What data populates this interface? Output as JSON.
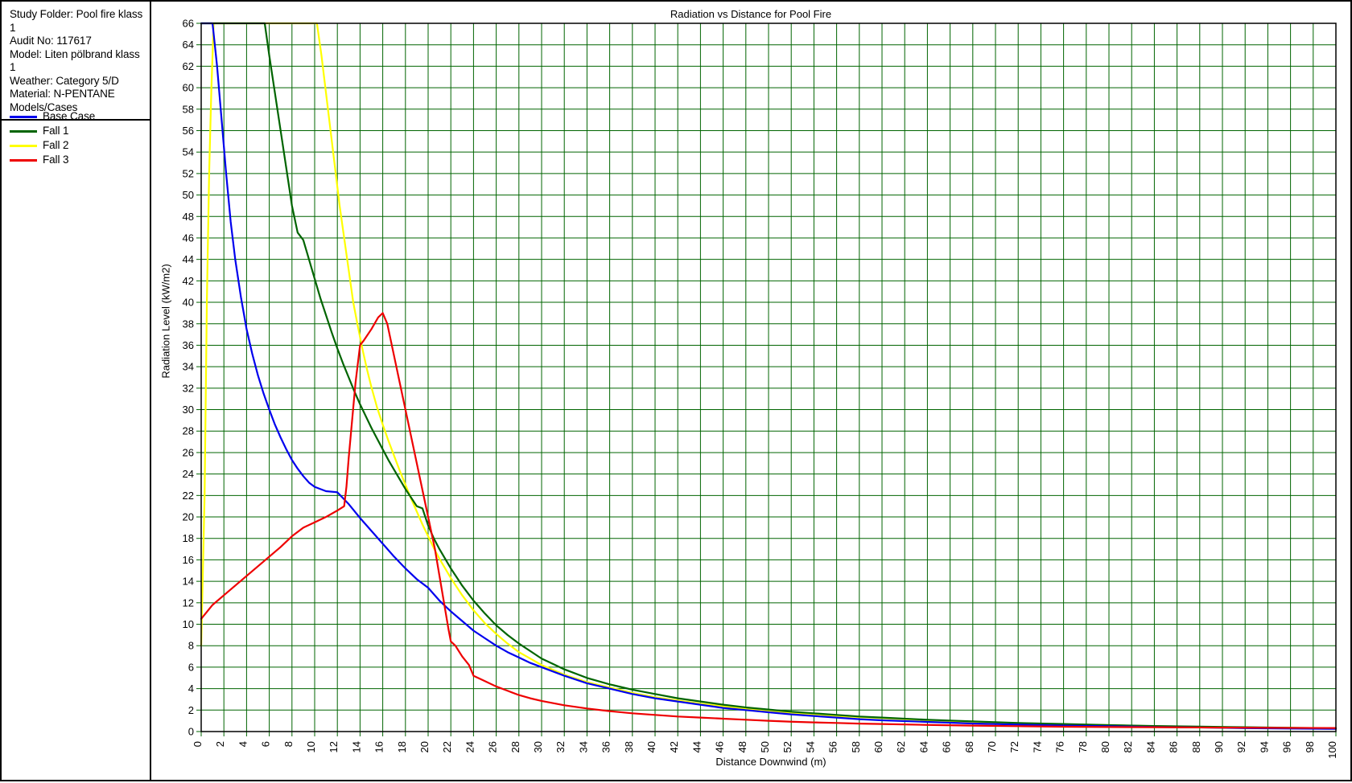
{
  "window": {
    "title": "Radiation vs Distance for Pool Fire"
  },
  "info_panel": {
    "lines": [
      "Study Folder: Pool fire klass 1",
      "Audit No: 117617",
      "Model: Liten pölbrand klass 1",
      "Weather: Category 5/D",
      "Material: N-PENTANE",
      "Models/Cases"
    ]
  },
  "legend": {
    "position": "left-panel",
    "items": [
      {
        "label": "Base Case",
        "color": "#0000ee"
      },
      {
        "label": "Fall 1",
        "color": "#006400"
      },
      {
        "label": "Fall 2",
        "color": "#ffff00"
      },
      {
        "label": "Fall 3",
        "color": "#ee0000"
      }
    ]
  },
  "chart_data": {
    "type": "line",
    "title": "Radiation vs Distance for Pool Fire",
    "xlabel": "Distance Downwind (m)",
    "ylabel": "Radiation Level (kW/m2)",
    "xlim": [
      0,
      100
    ],
    "ylim": [
      0,
      66
    ],
    "xticks": [
      0,
      2,
      4,
      6,
      8,
      10,
      12,
      14,
      16,
      18,
      20,
      22,
      24,
      26,
      28,
      30,
      32,
      34,
      36,
      38,
      40,
      42,
      44,
      46,
      48,
      50,
      52,
      54,
      56,
      58,
      60,
      62,
      64,
      66,
      68,
      70,
      72,
      74,
      76,
      78,
      80,
      82,
      84,
      86,
      88,
      90,
      92,
      94,
      96,
      98,
      100
    ],
    "yticks": [
      0,
      2,
      4,
      6,
      8,
      10,
      12,
      14,
      16,
      18,
      20,
      22,
      24,
      26,
      28,
      30,
      32,
      34,
      36,
      38,
      40,
      42,
      44,
      46,
      48,
      50,
      52,
      54,
      56,
      58,
      60,
      62,
      64,
      66
    ],
    "grid": true,
    "grid_color": "#006400",
    "axis_color": "#000000",
    "legend_position": "left-panel",
    "series": [
      {
        "name": "Base Case",
        "color": "#0000ee",
        "points": [
          [
            0.0,
            66.0
          ],
          [
            1.0,
            66.0
          ],
          [
            1.4,
            62.0
          ],
          [
            1.8,
            57.0
          ],
          [
            2.2,
            52.0
          ],
          [
            2.6,
            47.5
          ],
          [
            3.0,
            44.0
          ],
          [
            3.5,
            40.5
          ],
          [
            4.0,
            37.5
          ],
          [
            4.5,
            35.2
          ],
          [
            5.0,
            33.2
          ],
          [
            5.5,
            31.5
          ],
          [
            6.0,
            30.0
          ],
          [
            6.5,
            28.6
          ],
          [
            7.0,
            27.4
          ],
          [
            7.5,
            26.3
          ],
          [
            8.0,
            25.3
          ],
          [
            8.5,
            24.5
          ],
          [
            9.0,
            23.8
          ],
          [
            9.5,
            23.2
          ],
          [
            10.0,
            22.8
          ],
          [
            11.0,
            22.4
          ],
          [
            12.0,
            22.3
          ],
          [
            13.0,
            21.2
          ],
          [
            14.0,
            19.9
          ],
          [
            15.0,
            18.7
          ],
          [
            16.0,
            17.5
          ],
          [
            17.0,
            16.3
          ],
          [
            18.0,
            15.2
          ],
          [
            19.0,
            14.2
          ],
          [
            20.0,
            13.4
          ],
          [
            21.0,
            12.2
          ],
          [
            22.0,
            11.2
          ],
          [
            23.0,
            10.3
          ],
          [
            24.0,
            9.4
          ],
          [
            25.0,
            8.7
          ],
          [
            26.0,
            8.0
          ],
          [
            27.0,
            7.4
          ],
          [
            28.0,
            6.9
          ],
          [
            29.0,
            6.4
          ],
          [
            30.0,
            6.0
          ],
          [
            32.0,
            5.2
          ],
          [
            34.0,
            4.5
          ],
          [
            36.0,
            4.0
          ],
          [
            38.0,
            3.5
          ],
          [
            40.0,
            3.1
          ],
          [
            42.0,
            2.8
          ],
          [
            44.0,
            2.5
          ],
          [
            46.0,
            2.2
          ],
          [
            48.0,
            2.0
          ],
          [
            50.0,
            1.8
          ],
          [
            52.0,
            1.6
          ],
          [
            54.0,
            1.45
          ],
          [
            56.0,
            1.3
          ],
          [
            58.0,
            1.15
          ],
          [
            60.0,
            1.05
          ],
          [
            64.0,
            0.9
          ],
          [
            68.0,
            0.75
          ],
          [
            72.0,
            0.65
          ],
          [
            76.0,
            0.55
          ],
          [
            80.0,
            0.5
          ],
          [
            84.0,
            0.42
          ],
          [
            88.0,
            0.38
          ],
          [
            92.0,
            0.32
          ],
          [
            96.0,
            0.28
          ],
          [
            100.0,
            0.25
          ]
        ]
      },
      {
        "name": "Fall 1",
        "color": "#006400",
        "points": [
          [
            0.0,
            66.0
          ],
          [
            5.6,
            66.0
          ],
          [
            6.0,
            63.0
          ],
          [
            6.5,
            59.5
          ],
          [
            7.0,
            56.0
          ],
          [
            7.5,
            52.5
          ],
          [
            8.0,
            49.0
          ],
          [
            8.5,
            46.5
          ],
          [
            9.0,
            45.8
          ],
          [
            9.5,
            44.0
          ],
          [
            10.0,
            42.2
          ],
          [
            10.5,
            40.4
          ],
          [
            11.0,
            38.8
          ],
          [
            11.5,
            37.2
          ],
          [
            12.0,
            35.7
          ],
          [
            12.5,
            34.3
          ],
          [
            13.0,
            33.0
          ],
          [
            13.5,
            31.7
          ],
          [
            14.0,
            30.5
          ],
          [
            14.5,
            29.4
          ],
          [
            15.0,
            28.3
          ],
          [
            15.5,
            27.3
          ],
          [
            16.0,
            26.3
          ],
          [
            16.5,
            25.3
          ],
          [
            17.0,
            24.4
          ],
          [
            17.5,
            23.5
          ],
          [
            18.0,
            22.6
          ],
          [
            18.5,
            21.8
          ],
          [
            19.0,
            21.0
          ],
          [
            19.5,
            20.8
          ],
          [
            20.0,
            19.2
          ],
          [
            20.5,
            18.0
          ],
          [
            21.0,
            17.0
          ],
          [
            21.5,
            16.1
          ],
          [
            22.0,
            15.2
          ],
          [
            22.5,
            14.4
          ],
          [
            23.0,
            13.6
          ],
          [
            23.5,
            12.9
          ],
          [
            24.0,
            12.2
          ],
          [
            24.5,
            11.6
          ],
          [
            25.0,
            11.0
          ],
          [
            26.0,
            9.9
          ],
          [
            27.0,
            9.0
          ],
          [
            28.0,
            8.2
          ],
          [
            29.0,
            7.5
          ],
          [
            30.0,
            6.8
          ],
          [
            31.0,
            6.3
          ],
          [
            32.0,
            5.8
          ],
          [
            34.0,
            5.0
          ],
          [
            36.0,
            4.4
          ],
          [
            38.0,
            3.9
          ],
          [
            40.0,
            3.5
          ],
          [
            42.0,
            3.1
          ],
          [
            44.0,
            2.8
          ],
          [
            46.0,
            2.5
          ],
          [
            48.0,
            2.25
          ],
          [
            50.0,
            2.05
          ],
          [
            52.0,
            1.85
          ],
          [
            54.0,
            1.7
          ],
          [
            56.0,
            1.55
          ],
          [
            58.0,
            1.4
          ],
          [
            60.0,
            1.3
          ],
          [
            64.0,
            1.1
          ],
          [
            68.0,
            0.95
          ],
          [
            72.0,
            0.8
          ],
          [
            76.0,
            0.7
          ],
          [
            80.0,
            0.6
          ],
          [
            84.0,
            0.52
          ],
          [
            88.0,
            0.46
          ],
          [
            92.0,
            0.4
          ],
          [
            96.0,
            0.35
          ],
          [
            100.0,
            0.3
          ]
        ]
      },
      {
        "name": "Fall 2",
        "color": "#ffff00",
        "points": [
          [
            0.0,
            8.0
          ],
          [
            0.3,
            22.0
          ],
          [
            0.5,
            40.0
          ],
          [
            0.7,
            52.0
          ],
          [
            0.9,
            60.0
          ],
          [
            1.1,
            66.0
          ],
          [
            10.2,
            66.0
          ],
          [
            10.6,
            63.0
          ],
          [
            11.0,
            59.5
          ],
          [
            11.4,
            56.0
          ],
          [
            11.8,
            52.5
          ],
          [
            12.2,
            49.0
          ],
          [
            12.6,
            46.0
          ],
          [
            13.0,
            43.0
          ],
          [
            13.4,
            40.0
          ],
          [
            13.8,
            37.8
          ],
          [
            14.2,
            35.7
          ],
          [
            14.6,
            33.8
          ],
          [
            15.0,
            32.1
          ],
          [
            15.5,
            30.2
          ],
          [
            16.0,
            28.6
          ],
          [
            16.5,
            27.1
          ],
          [
            17.0,
            25.7
          ],
          [
            17.5,
            24.3
          ],
          [
            18.0,
            23.0
          ],
          [
            18.5,
            21.7
          ],
          [
            19.0,
            20.5
          ],
          [
            19.5,
            19.3
          ],
          [
            20.0,
            18.2
          ],
          [
            20.5,
            17.1
          ],
          [
            21.0,
            16.1
          ],
          [
            21.5,
            15.2
          ],
          [
            22.0,
            14.3
          ],
          [
            22.5,
            13.5
          ],
          [
            23.0,
            12.7
          ],
          [
            23.5,
            12.0
          ],
          [
            24.0,
            11.3
          ],
          [
            25.0,
            10.1
          ],
          [
            26.0,
            9.1
          ],
          [
            27.0,
            8.2
          ],
          [
            28.0,
            7.4
          ],
          [
            29.0,
            6.8
          ],
          [
            30.0,
            6.2
          ],
          [
            32.0,
            5.3
          ],
          [
            34.0,
            4.6
          ],
          [
            36.0,
            4.1
          ],
          [
            38.0,
            3.6
          ],
          [
            40.0,
            3.2
          ],
          [
            42.0,
            2.9
          ],
          [
            44.0,
            2.6
          ],
          [
            46.0,
            2.35
          ],
          [
            48.0,
            2.1
          ],
          [
            50.0,
            1.9
          ],
          [
            52.0,
            1.75
          ],
          [
            54.0,
            1.6
          ],
          [
            56.0,
            1.45
          ],
          [
            58.0,
            1.35
          ],
          [
            60.0,
            1.25
          ],
          [
            64.0,
            1.05
          ],
          [
            68.0,
            0.9
          ],
          [
            72.0,
            0.78
          ],
          [
            76.0,
            0.68
          ],
          [
            80.0,
            0.6
          ],
          [
            84.0,
            0.5
          ],
          [
            88.0,
            0.44
          ],
          [
            92.0,
            0.38
          ],
          [
            96.0,
            0.34
          ],
          [
            100.0,
            0.3
          ]
        ]
      },
      {
        "name": "Fall 3",
        "color": "#ee0000",
        "points": [
          [
            0.0,
            10.5
          ],
          [
            1.0,
            11.8
          ],
          [
            2.0,
            12.7
          ],
          [
            3.0,
            13.6
          ],
          [
            4.0,
            14.5
          ],
          [
            5.0,
            15.4
          ],
          [
            6.0,
            16.3
          ],
          [
            7.0,
            17.2
          ],
          [
            8.0,
            18.2
          ],
          [
            9.0,
            19.0
          ],
          [
            10.0,
            19.5
          ],
          [
            11.0,
            20.0
          ],
          [
            12.0,
            20.6
          ],
          [
            12.6,
            21.0
          ],
          [
            12.8,
            22.8
          ],
          [
            13.0,
            25.5
          ],
          [
            13.3,
            29.0
          ],
          [
            13.6,
            32.5
          ],
          [
            14.0,
            36.0
          ],
          [
            14.3,
            36.4
          ],
          [
            15.0,
            37.5
          ],
          [
            15.6,
            38.6
          ],
          [
            16.0,
            39.0
          ],
          [
            16.4,
            38.0
          ],
          [
            17.0,
            35.0
          ],
          [
            17.6,
            32.0
          ],
          [
            18.2,
            29.0
          ],
          [
            18.8,
            26.0
          ],
          [
            19.4,
            23.0
          ],
          [
            20.0,
            20.0
          ],
          [
            20.6,
            17.0
          ],
          [
            21.0,
            14.5
          ],
          [
            21.4,
            12.0
          ],
          [
            21.8,
            9.5
          ],
          [
            22.0,
            8.4
          ],
          [
            22.4,
            8.0
          ],
          [
            23.0,
            7.0
          ],
          [
            23.6,
            6.2
          ],
          [
            24.0,
            5.2
          ],
          [
            25.0,
            4.7
          ],
          [
            26.0,
            4.2
          ],
          [
            27.0,
            3.8
          ],
          [
            28.0,
            3.4
          ],
          [
            29.0,
            3.1
          ],
          [
            30.0,
            2.85
          ],
          [
            32.0,
            2.45
          ],
          [
            34.0,
            2.15
          ],
          [
            36.0,
            1.9
          ],
          [
            38.0,
            1.7
          ],
          [
            40.0,
            1.55
          ],
          [
            42.0,
            1.4
          ],
          [
            44.0,
            1.3
          ],
          [
            46.0,
            1.2
          ],
          [
            48.0,
            1.1
          ],
          [
            50.0,
            1.0
          ],
          [
            52.0,
            0.92
          ],
          [
            54.0,
            0.85
          ],
          [
            56.0,
            0.8
          ],
          [
            58.0,
            0.74
          ],
          [
            60.0,
            0.7
          ],
          [
            64.0,
            0.62
          ],
          [
            68.0,
            0.55
          ],
          [
            72.0,
            0.5
          ],
          [
            76.0,
            0.45
          ],
          [
            80.0,
            0.42
          ],
          [
            84.0,
            0.4
          ],
          [
            88.0,
            0.38
          ],
          [
            92.0,
            0.36
          ],
          [
            96.0,
            0.34
          ],
          [
            100.0,
            0.33
          ]
        ]
      }
    ]
  }
}
